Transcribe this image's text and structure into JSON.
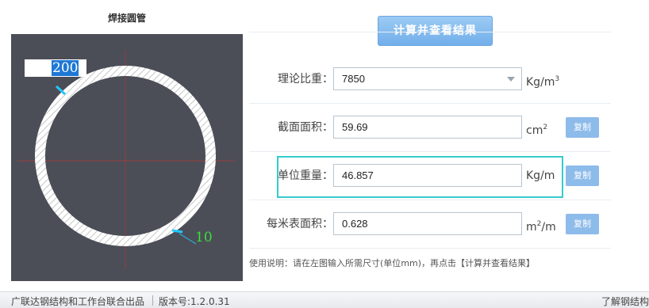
{
  "panel": {
    "title": "焊接圆管",
    "diameter": "200",
    "thickness": "10"
  },
  "calc_button": "计算并查看结果",
  "rows": {
    "density": {
      "label": "理论比重：",
      "value": "7850",
      "unit_base": "Kg/m",
      "unit_sup": "3"
    },
    "area": {
      "label": "截面面积：",
      "value": "59.69",
      "unit_base": "cm",
      "unit_sup": "2",
      "copy": "复制"
    },
    "weight": {
      "label": "单位重量：",
      "value": "46.857",
      "unit_base": "Kg/m",
      "copy": "复制"
    },
    "surface": {
      "label": "每米表面积：",
      "value": "0.628",
      "unit_base": "m",
      "unit_sup": "2",
      "unit_tail": "/m",
      "copy": "复制"
    }
  },
  "usage": "使用说明：请在左图输入所需尺寸(单位mm)，再点击【计算并查看结果】",
  "footer": {
    "left": "广联达钢结构和工作台联合出品",
    "version": "版本号:1.2.0.31",
    "right": "了解钢结构"
  },
  "colors": {
    "canvas_bg": "#4b4e57",
    "button": "#7ab3ec",
    "highlight": "#35cccc",
    "thickness_label": "#3bdf3b",
    "diameter_text": "#1d6fd0"
  }
}
